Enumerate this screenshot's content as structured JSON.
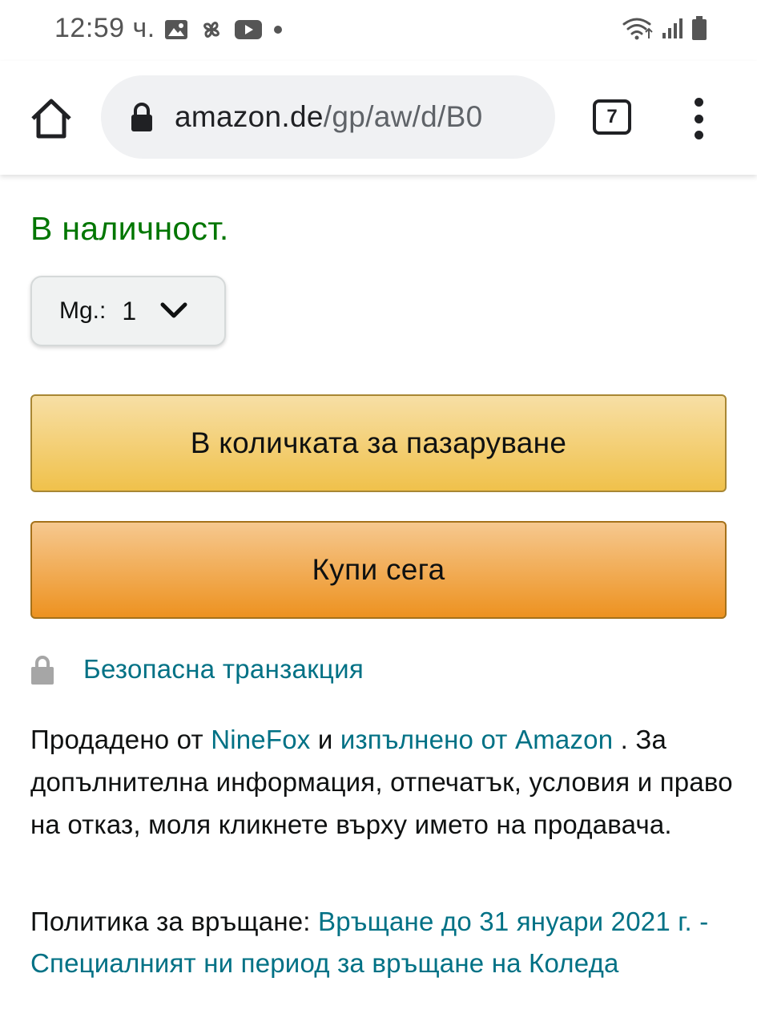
{
  "status_bar": {
    "time": "12:59 ч.",
    "icons_left": [
      "image-icon",
      "pinwheel-icon",
      "youtube-icon",
      "dot-icon"
    ],
    "icons_right": [
      "wifi-icon",
      "signal-icon",
      "battery-icon"
    ]
  },
  "browser": {
    "url_host": "amazon.de",
    "url_path": "/gp/aw/d/B0",
    "tab_count": "7"
  },
  "product": {
    "availability": "В наличност.",
    "quantity_label": "Mg.:",
    "quantity_value": "1",
    "add_to_cart_label": "В количката за пазаруване",
    "buy_now_label": "Купи сега",
    "secure_transaction": "Безопасна транзакция",
    "sold_by_prefix": "Продадено от ",
    "seller_name": "NineFox",
    "sold_by_and": " и ",
    "fulfilled_by": "изпълнено от Amazon",
    "sold_by_suffix": " . За допълнителна информация, отпечатък, условия и право на отказ, моля кликнете върху името на продавача.",
    "return_policy_label": "Политика за връщане: ",
    "return_policy_link": "Връщане до 31 януари 2021 г. - Специалният ни период за връщане на Коледа"
  },
  "colors": {
    "in_stock": "#007600",
    "link": "#007185",
    "cart_button": "#f0c14b",
    "buy_button": "#ed9220"
  }
}
